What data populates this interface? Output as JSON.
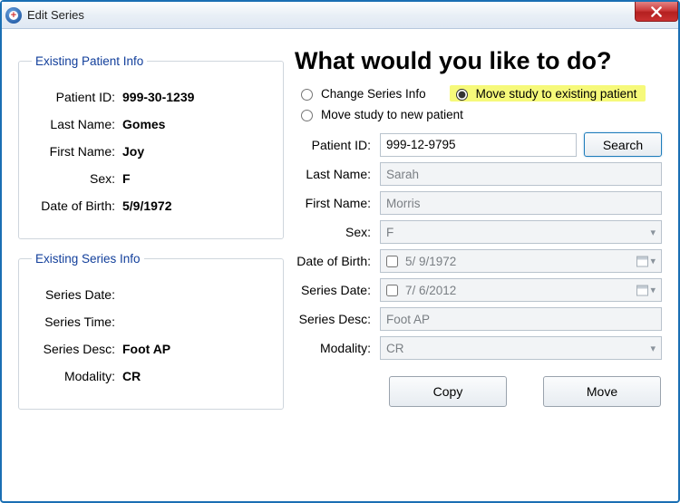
{
  "window": {
    "title": "Edit Series"
  },
  "existing_patient": {
    "legend": "Existing Patient Info",
    "labels": {
      "patient_id": "Patient ID:",
      "last_name": "Last Name:",
      "first_name": "First Name:",
      "sex": "Sex:",
      "dob": "Date of Birth:"
    },
    "values": {
      "patient_id": "999-30-1239",
      "last_name": "Gomes",
      "first_name": "Joy",
      "sex": "F",
      "dob": "5/9/1972"
    }
  },
  "existing_series": {
    "legend": "Existing Series Info",
    "labels": {
      "series_date": "Series Date:",
      "series_time": "Series Time:",
      "series_desc": "Series Desc:",
      "modality": "Modality:"
    },
    "values": {
      "series_date": "",
      "series_time": "",
      "series_desc": "Foot AP",
      "modality": "CR"
    }
  },
  "heading": "What would you like to do?",
  "radios": {
    "change": "Change Series Info",
    "move_new": "Move study to new patient",
    "move_existing": "Move study to existing patient",
    "selected": "move_existing"
  },
  "form": {
    "labels": {
      "patient_id": "Patient ID:",
      "last_name": "Last Name:",
      "first_name": "First Name:",
      "sex": "Sex:",
      "dob": "Date of Birth:",
      "series_date": "Series Date:",
      "series_desc": "Series Desc:",
      "modality": "Modality:"
    },
    "values": {
      "patient_id": "999-12-9795",
      "last_name": "Sarah",
      "first_name": "Morris",
      "sex": "F",
      "dob": "5/ 9/1972",
      "series_date": "7/  6/2012",
      "series_desc": "Foot AP",
      "modality": "CR"
    },
    "buttons": {
      "search": "Search",
      "copy": "Copy",
      "move": "Move"
    }
  }
}
